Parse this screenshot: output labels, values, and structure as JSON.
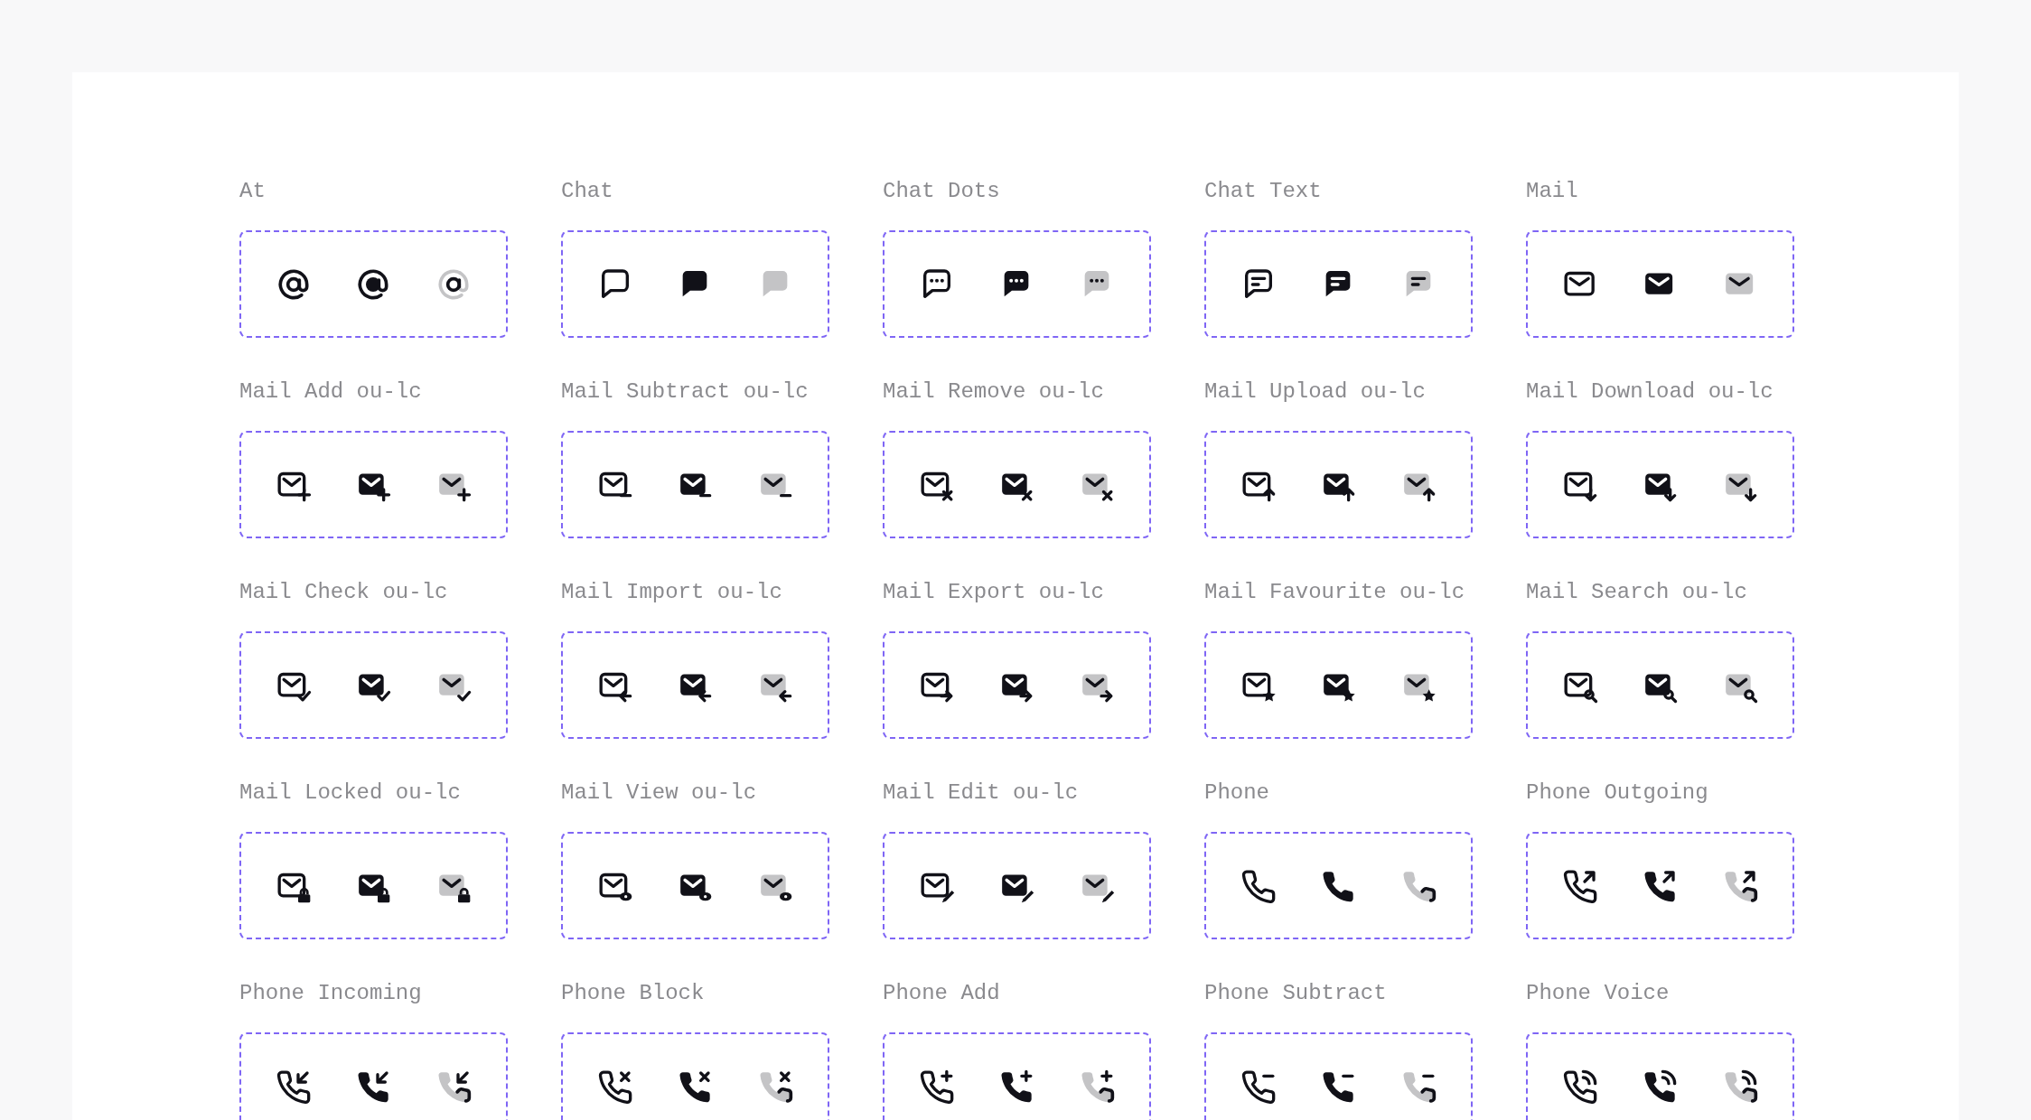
{
  "icons": [
    {
      "label": "At",
      "kind": "at"
    },
    {
      "label": "Chat",
      "kind": "chat"
    },
    {
      "label": "Chat Dots",
      "kind": "chatdots"
    },
    {
      "label": "Chat Text",
      "kind": "chattext"
    },
    {
      "label": "Mail",
      "kind": "mail"
    },
    {
      "label": "Mail Add ou-lc",
      "kind": "mailplus"
    },
    {
      "label": "Mail Subtract ou-lc",
      "kind": "mailminus"
    },
    {
      "label": "Mail Remove ou-lc",
      "kind": "mailcross"
    },
    {
      "label": "Mail Upload ou-lc",
      "kind": "mailup"
    },
    {
      "label": "Mail Download ou-lc",
      "kind": "maildown"
    },
    {
      "label": "Mail Check ou-lc",
      "kind": "mailcheck"
    },
    {
      "label": "Mail Import ou-lc",
      "kind": "mailleft"
    },
    {
      "label": "Mail Export ou-lc",
      "kind": "mailright"
    },
    {
      "label": "Mail Favourite ou-lc",
      "kind": "mailstar"
    },
    {
      "label": "Mail Search ou-lc",
      "kind": "mailsearch"
    },
    {
      "label": "Mail Locked ou-lc",
      "kind": "maillock"
    },
    {
      "label": "Mail View ou-lc",
      "kind": "maileye"
    },
    {
      "label": "Mail Edit ou-lc",
      "kind": "mailpencil"
    },
    {
      "label": "Phone",
      "kind": "phone"
    },
    {
      "label": "Phone Outgoing",
      "kind": "phoneoutgoing"
    },
    {
      "label": "Phone Incoming",
      "kind": "phoneincoming"
    },
    {
      "label": "Phone Block",
      "kind": "phonecross"
    },
    {
      "label": "Phone Add",
      "kind": "phoneplus"
    },
    {
      "label": "Phone Subtract",
      "kind": "phoneminus"
    },
    {
      "label": "Phone Voice",
      "kind": "phonevoice"
    }
  ]
}
